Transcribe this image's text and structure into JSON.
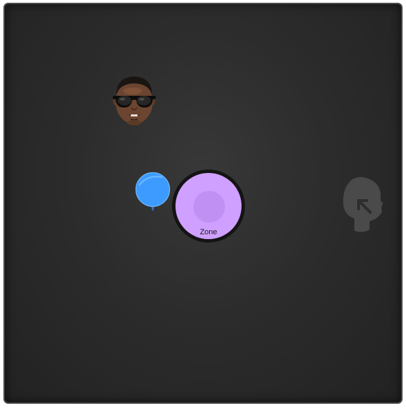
{
  "canvas": {
    "background_color": "#2c2c2c",
    "border_color": "#4a4a4a"
  },
  "avatar": {
    "icon": "sunglasses-face-avatar-icon"
  },
  "cursor_dot": {
    "icon": "blue-pin-dot-icon",
    "color": "#3d9bff"
  },
  "zone": {
    "label": "Zone",
    "fill_color": "#cfa0ff",
    "ring_color": "#141414"
  },
  "ghost_head": {
    "icon": "head-silhouette-pointer-icon",
    "color": "#4a4a4a"
  }
}
